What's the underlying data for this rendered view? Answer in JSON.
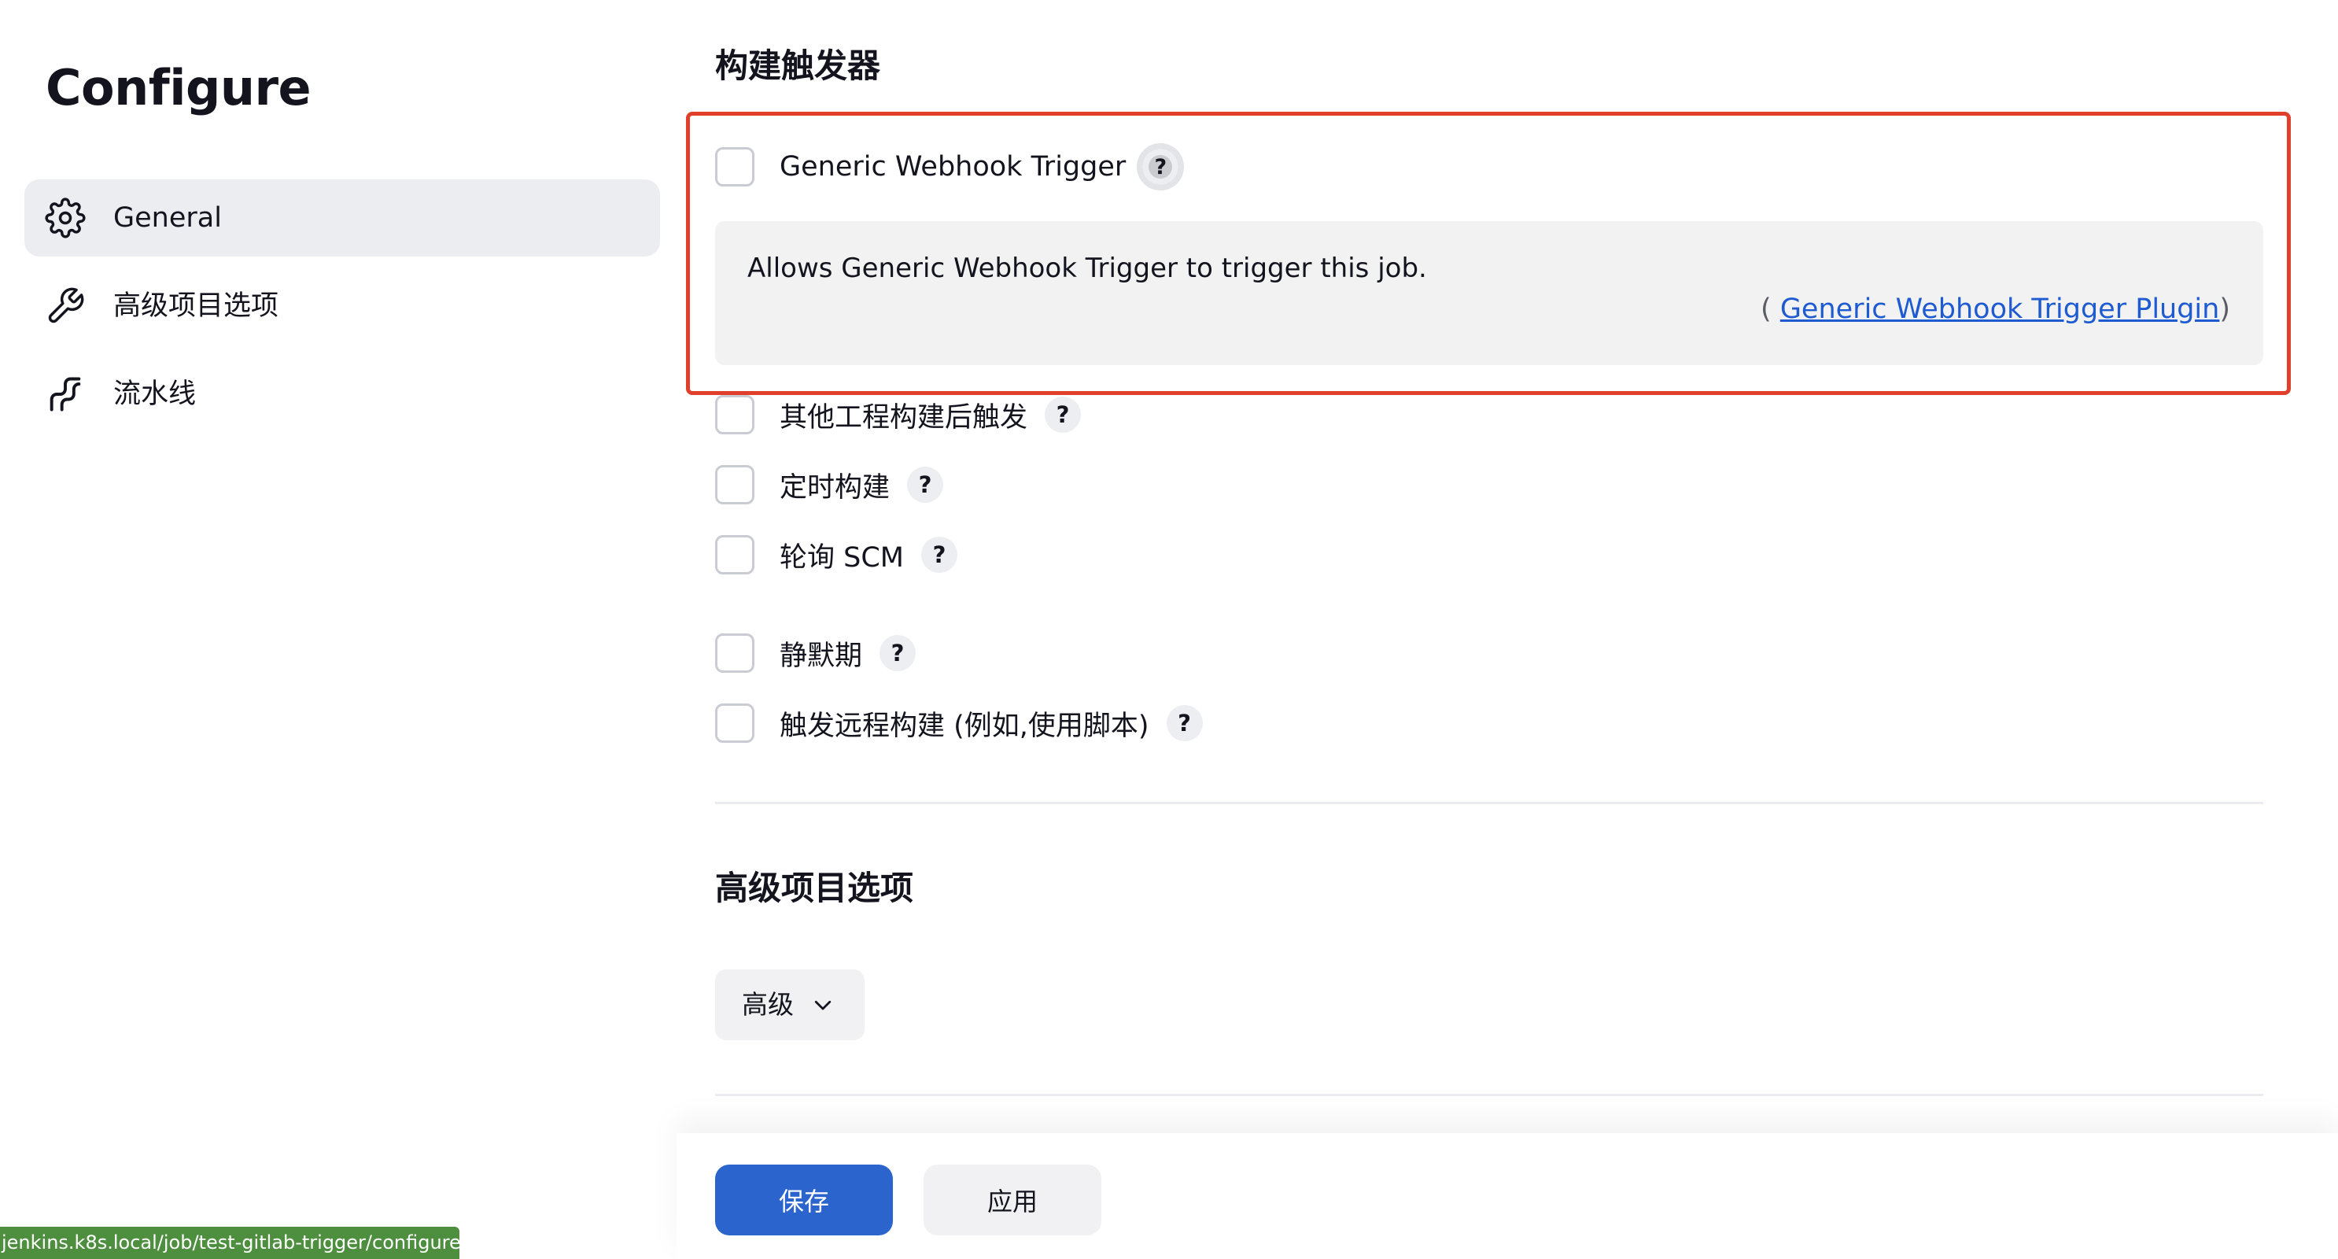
{
  "page": {
    "title": "Configure"
  },
  "sidebar": {
    "items": [
      {
        "label": "General",
        "icon": "gear-icon",
        "active": true
      },
      {
        "label": "高级项目选项",
        "icon": "wrench-icon",
        "active": false
      },
      {
        "label": "流水线",
        "icon": "pipeline-icon",
        "active": false
      }
    ]
  },
  "triggers": {
    "section_title": "构建触发器",
    "options": [
      {
        "label": "Generic Webhook Trigger",
        "checked": false
      },
      {
        "label": "其他工程构建后触发",
        "checked": false
      },
      {
        "label": "定时构建",
        "checked": false
      },
      {
        "label": "轮询 SCM",
        "checked": false
      },
      {
        "label": "静默期",
        "checked": false
      },
      {
        "label": "触发远程构建 (例如,使用脚本)",
        "checked": false
      }
    ],
    "help_symbol": "?",
    "help_panel": {
      "text": "Allows Generic Webhook Trigger to trigger this job.",
      "source_open": "( ",
      "source_link": "Generic Webhook Trigger Plugin",
      "source_close": ")"
    }
  },
  "advanced": {
    "section_title": "高级项目选项",
    "dropdown_label": "高级"
  },
  "actions": {
    "save_label": "保存",
    "apply_label": "应用"
  },
  "status_bar": {
    "url": "jenkins.k8s.local/job/test-gitlab-trigger/configure#"
  },
  "colors": {
    "highlight_border": "#e0402b",
    "primary_button": "#2a64cc",
    "link": "#1e5bd1",
    "status_bar_bg": "#4e8f3f"
  }
}
